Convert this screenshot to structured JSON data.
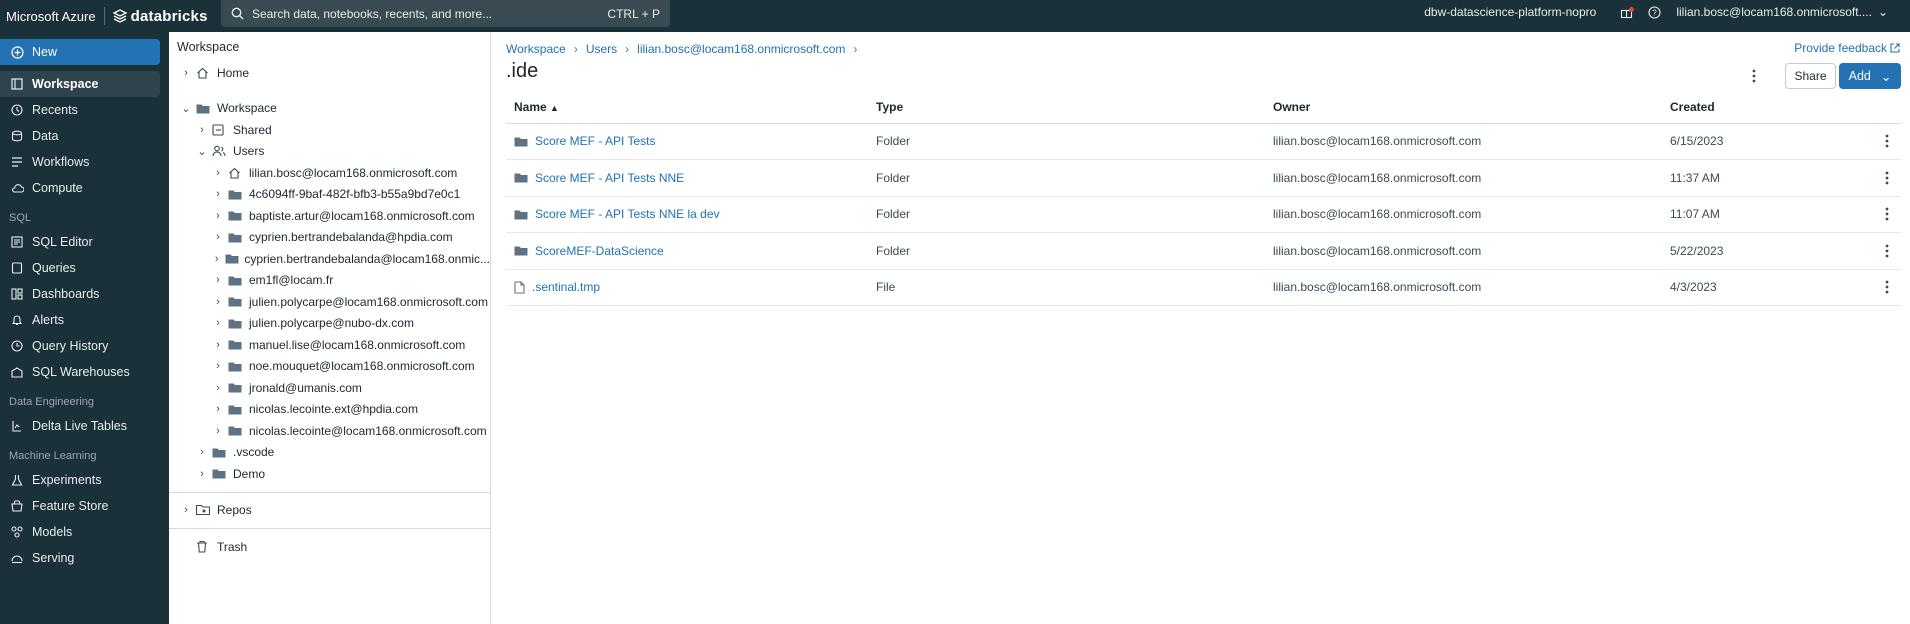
{
  "topbar": {
    "brand": "Microsoft Azure",
    "product": "databricks",
    "search_placeholder": "Search data, notebooks, recents, and more...",
    "search_shortcut": "CTRL + P",
    "workspace": "dbw-datascience-platform-nopro",
    "user": "lilian.bosc@locam168.onmicrosoft...."
  },
  "nav": {
    "new_label": "New",
    "main": [
      "Workspace",
      "Recents",
      "Data",
      "Workflows",
      "Compute"
    ],
    "sql_section": "SQL",
    "sql": [
      "SQL Editor",
      "Queries",
      "Dashboards",
      "Alerts",
      "Query History",
      "SQL Warehouses"
    ],
    "de_section": "Data Engineering",
    "de": [
      "Delta Live Tables"
    ],
    "ml_section": "Machine Learning",
    "ml": [
      "Experiments",
      "Feature Store",
      "Models",
      "Serving"
    ]
  },
  "tree": {
    "title": "Workspace",
    "home": "Home",
    "workspace": "Workspace",
    "shared": "Shared",
    "users": "Users",
    "user_folders": [
      "lilian.bosc@locam168.onmicrosoft.com",
      "4c6094ff-9baf-482f-bfb3-b55a9bd7e0c1",
      "baptiste.artur@locam168.onmicrosoft.com",
      "cyprien.bertrandebalanda@hpdia.com",
      "cyprien.bertrandebalanda@locam168.onmic...",
      "em1fl@locam.fr",
      "julien.polycarpe@locam168.onmicrosoft.com",
      "julien.polycarpe@nubo-dx.com",
      "manuel.lise@locam168.onmicrosoft.com",
      "noe.mouquet@locam168.onmicrosoft.com",
      "jronald@umanis.com",
      "nicolas.lecointe.ext@hpdia.com",
      "nicolas.lecointe@locam168.onmicrosoft.com"
    ],
    "vscode": ".vscode",
    "demo": "Demo",
    "repos": "Repos",
    "trash": "Trash"
  },
  "main": {
    "breadcrumb": [
      "Workspace",
      "Users",
      "lilian.bosc@locam168.onmicrosoft.com"
    ],
    "title": ".ide",
    "feedback": "Provide feedback",
    "share": "Share",
    "add": "Add",
    "columns": {
      "name": "Name",
      "type": "Type",
      "owner": "Owner",
      "created": "Created"
    },
    "rows": [
      {
        "name": "Score MEF - API Tests",
        "type": "Folder",
        "owner": "lilian.bosc@locam168.onmicrosoft.com",
        "created": "6/15/2023",
        "icon": "folder-icon"
      },
      {
        "name": "Score MEF - API Tests NNE",
        "type": "Folder",
        "owner": "lilian.bosc@locam168.onmicrosoft.com",
        "created": "11:37 AM",
        "icon": "folder-icon"
      },
      {
        "name": "Score MEF - API Tests NNE la dev",
        "type": "Folder",
        "owner": "lilian.bosc@locam168.onmicrosoft.com",
        "created": "11:07 AM",
        "icon": "folder-icon"
      },
      {
        "name": "ScoreMEF-DataScience",
        "type": "Folder",
        "owner": "lilian.bosc@locam168.onmicrosoft.com",
        "created": "5/22/2023",
        "icon": "folder-icon"
      },
      {
        "name": ".sentinal.tmp",
        "type": "File",
        "owner": "lilian.bosc@locam168.onmicrosoft.com",
        "created": "4/3/2023",
        "icon": "file-icon"
      }
    ]
  },
  "colors": {
    "nav_bg": "#1b3139",
    "accent": "#2272b4"
  }
}
